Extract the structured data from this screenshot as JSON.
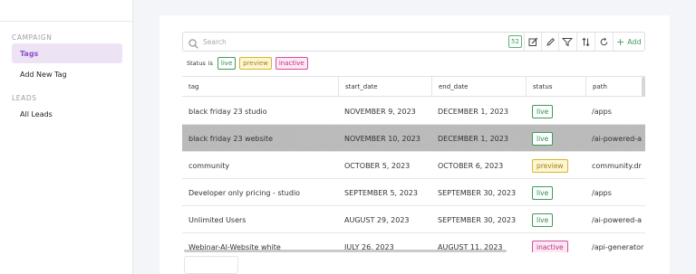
{
  "sidebar": {
    "sections": [
      {
        "heading": "CAMPAIGN",
        "items": [
          {
            "label": "Tags",
            "active": true
          },
          {
            "label": "Add New Tag",
            "active": false
          }
        ]
      },
      {
        "heading": "LEADS",
        "items": [
          {
            "label": "All Leads",
            "active": false
          }
        ]
      }
    ]
  },
  "toolbar": {
    "search_placeholder": "Search",
    "search_value": "",
    "count": "52",
    "add_label": "Add",
    "icons": [
      "edit-icon",
      "pencil-icon",
      "filter-icon",
      "sort-icon",
      "refresh-icon",
      "plus-icon"
    ]
  },
  "filter": {
    "label": "Status",
    "operator": "is",
    "chips": [
      "live",
      "preview",
      "inactive"
    ]
  },
  "table": {
    "columns": [
      "tag",
      "start_date",
      "end_date",
      "status",
      "path"
    ],
    "rows": [
      {
        "tag": "black friday 23 studio",
        "start_date": "NOVEMBER 9, 2023",
        "end_date": "DECEMBER 1, 2023",
        "status": "live",
        "path": "/apps",
        "selected": false
      },
      {
        "tag": "black friday 23 website",
        "start_date": "NOVEMBER 10, 2023",
        "end_date": "DECEMBER 1, 2023",
        "status": "live",
        "path": "/ai-powered-a",
        "selected": true
      },
      {
        "tag": "community",
        "start_date": "OCTOBER 5, 2023",
        "end_date": "OCTOBER 6, 2023",
        "status": "preview",
        "path": "community.dr",
        "selected": false
      },
      {
        "tag": "Developer only pricing - studio",
        "start_date": "SEPTEMBER 5, 2023",
        "end_date": "SEPTEMBER 30, 2023",
        "status": "live",
        "path": "/apps",
        "selected": false
      },
      {
        "tag": "Unlimited Users",
        "start_date": "AUGUST 29, 2023",
        "end_date": "SEPTEMBER 30, 2023",
        "status": "live",
        "path": "/ai-powered-a",
        "selected": false
      },
      {
        "tag": "Webinar-AI-Website white",
        "start_date": "JULY 26, 2023",
        "end_date": "AUGUST 11, 2023",
        "status": "inactive",
        "path": "/api-generator",
        "selected": false
      }
    ]
  },
  "colors": {
    "accent": "#8f4fc8",
    "live": "#2f8a4c",
    "preview": "#a48216",
    "inactive": "#c02f86"
  }
}
